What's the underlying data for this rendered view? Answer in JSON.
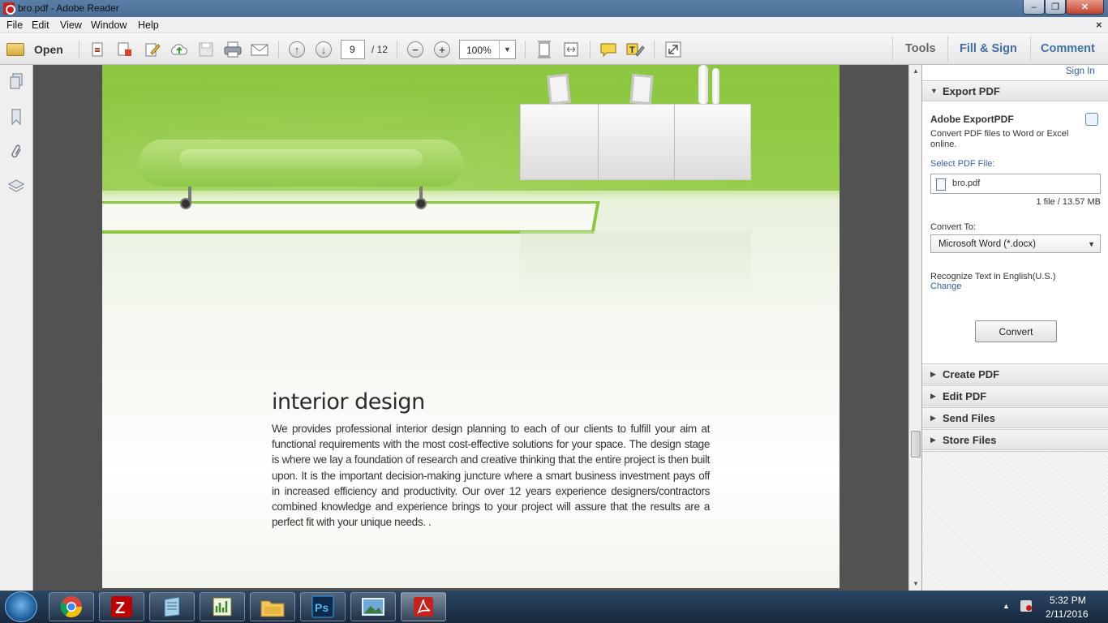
{
  "window": {
    "title": "bro.pdf - Adobe Reader",
    "min_glyph": "‒",
    "max_glyph": "❐",
    "close_glyph": "✕"
  },
  "menu": {
    "items": [
      "File",
      "Edit",
      "View",
      "Window",
      "Help"
    ],
    "doc_close": "×"
  },
  "toolbar": {
    "open_label": "Open",
    "page_current": "9",
    "page_total": "/ 12",
    "zoom": "100%",
    "zoom_dd": "▼",
    "tools_label": "Tools",
    "fill_sign_label": "Fill & Sign",
    "comment_label": "Comment"
  },
  "document": {
    "heading": "interior design",
    "body": "We provides professional interior design planning to each of our clients to fulfill your aim at functional requirements with the most cost-effective solutions for your space. The design stage is where we lay a foundation of research and creative thinking that the entire project is then built upon. It is the important decision-making juncture where a smart business investment pays off in increased efficiency and productivity. Our over 12 years experience designers/contractors combined knowledge and experience brings to your project will assure that the results are a perfect fit with your unique needs. ."
  },
  "right_pane": {
    "sign_in": "Sign In",
    "export_pdf": {
      "header": "Export PDF",
      "title": "Adobe ExportPDF",
      "description": "Convert PDF files to Word or Excel online.",
      "select_label": "Select PDF File:",
      "file_name": "bro.pdf",
      "file_size": "1 file / 13.57 MB",
      "convert_to_label": "Convert To:",
      "convert_to_value": "Microsoft Word (*.docx)",
      "recognize_text": "Recognize Text in English(U.S.)",
      "change_link": "Change",
      "convert_button": "Convert"
    },
    "sections": [
      "Create PDF",
      "Edit PDF",
      "Send Files",
      "Store Files"
    ],
    "expanded_arrow": "▼",
    "collapsed_arrow": "▶"
  },
  "taskbar": {
    "apps": [
      "chrome-icon",
      "filezilla-icon",
      "notepad-icon",
      "chart-tool-icon",
      "file-explorer-icon",
      "photoshop-icon",
      "photo-viewer-icon",
      "adobe-reader-icon"
    ],
    "time": "5:32 PM",
    "date": "2/11/2016"
  },
  "colors": {
    "accent_blue": "#3f6fa6",
    "link_blue": "#2f5fa3",
    "wall_green": "#8cc63f"
  }
}
